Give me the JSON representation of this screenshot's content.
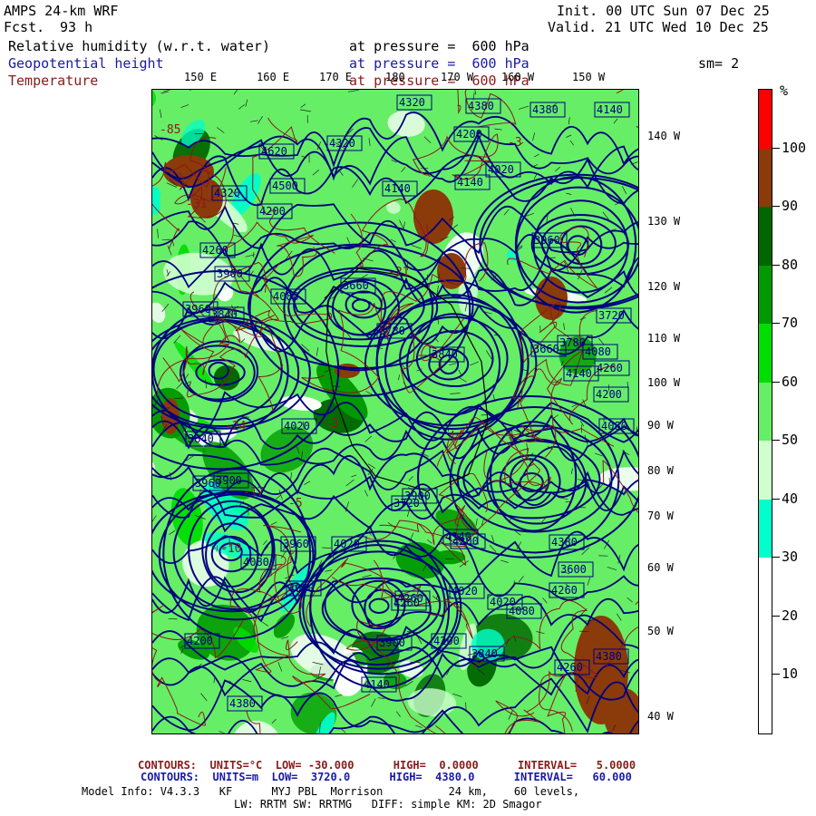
{
  "header": {
    "model": "AMPS 24-km WRF",
    "fcst_label": "Fcst.",
    "fcst_value": "93 h",
    "init": "Init. 00 UTC Sun 07 Dec 25",
    "valid": "Valid. 21 UTC Wed 10 Dec 25",
    "fields": [
      {
        "name": "Relative humidity (w.r.t. water)",
        "level": "at pressure =  600 hPa",
        "color": "#000000"
      },
      {
        "name": "Geopotential height",
        "level": "at pressure =  600 hPa",
        "color": "#1a1aa6"
      },
      {
        "name": "Temperature",
        "level": "at pressure =  600 hPa",
        "color": "#8b1a1a"
      }
    ],
    "smoothing": "sm= 2"
  },
  "map": {
    "lon_labels_top": [
      "150 E",
      "160 E",
      "170 E",
      "180",
      "170 W",
      "160 W",
      "150 W"
    ],
    "lat_labels_right": [
      "140 W",
      "130 W",
      "120 W",
      "110 W",
      "100 W",
      "90 W",
      "80 W",
      "70 W",
      "60 W",
      "50 W",
      "40 W"
    ],
    "height_labels": [
      "4320",
      "4380",
      "4620",
      "4320",
      "4140",
      "4200",
      "4260",
      "4320",
      "4500",
      "4140",
      "4200",
      "4380",
      "4020",
      "3960",
      "4140",
      "3900",
      "3840",
      "3960",
      "3660",
      "3780",
      "4080",
      "3840",
      "3900",
      "4020",
      "3720",
      "3960",
      "3840",
      "3900",
      "4140",
      "4080",
      "4020",
      "4260",
      "4200",
      "4380",
      "3720",
      "3780",
      "3660",
      "4140",
      "4080",
      "4200",
      "4260",
      "3600",
      "4020",
      "4080",
      "3900",
      "4140",
      "4200",
      "4260",
      "4380",
      "4020",
      "4260",
      "3840",
      "4380",
      "3960",
      "4200",
      "4080",
      "4080",
      "4260"
    ],
    "temp_labels": [
      "-85",
      "-3",
      "-17",
      "-3",
      "-31",
      "-21",
      "-24",
      "-5",
      "-10"
    ],
    "colors": {
      "rh_30_40": "#00ffcc",
      "rh_40_50": "#cfffcf",
      "rh_50_60": "#66ee66",
      "rh_60_70": "#00dd00",
      "rh_70_80": "#009900",
      "rh_80_90": "#006600",
      "rh_90_100": "#8b3a0a",
      "rh_100": "#ff0000",
      "height_contour": "#000080",
      "temp_contour": "#8b1a1a",
      "coast": "#000000"
    }
  },
  "colorbar": {
    "unit": "%",
    "ticks": [
      "100",
      "90",
      "80",
      "70",
      "60",
      "50",
      "40",
      "30",
      "20",
      "10"
    ],
    "segments": [
      {
        "color": "#ff0000"
      },
      {
        "color": "#8b3a0a"
      },
      {
        "color": "#006600"
      },
      {
        "color": "#009900"
      },
      {
        "color": "#00dd00"
      },
      {
        "color": "#66ee66"
      },
      {
        "color": "#cfffcf"
      },
      {
        "color": "#00ffcc"
      },
      {
        "color": "#ffffff"
      },
      {
        "color": "#ffffff"
      },
      {
        "color": "#ffffff"
      }
    ]
  },
  "footer": {
    "temp_contours": "CONTOURS:  UNITS=°C  LOW= -30.000      HIGH=  0.0000      INTERVAL=   5.0000",
    "height_contours": "CONTOURS:  UNITS=m  LOW=  3720.0      HIGH=  4380.0      INTERVAL=   60.000",
    "model_info_1": "Model Info: V4.3.3   KF      MYJ PBL  Morrison          24 km,    60 levels,",
    "model_info_2": "LW: RRTM SW: RRTMG   DIFF: simple KM: 2D Smagor"
  }
}
